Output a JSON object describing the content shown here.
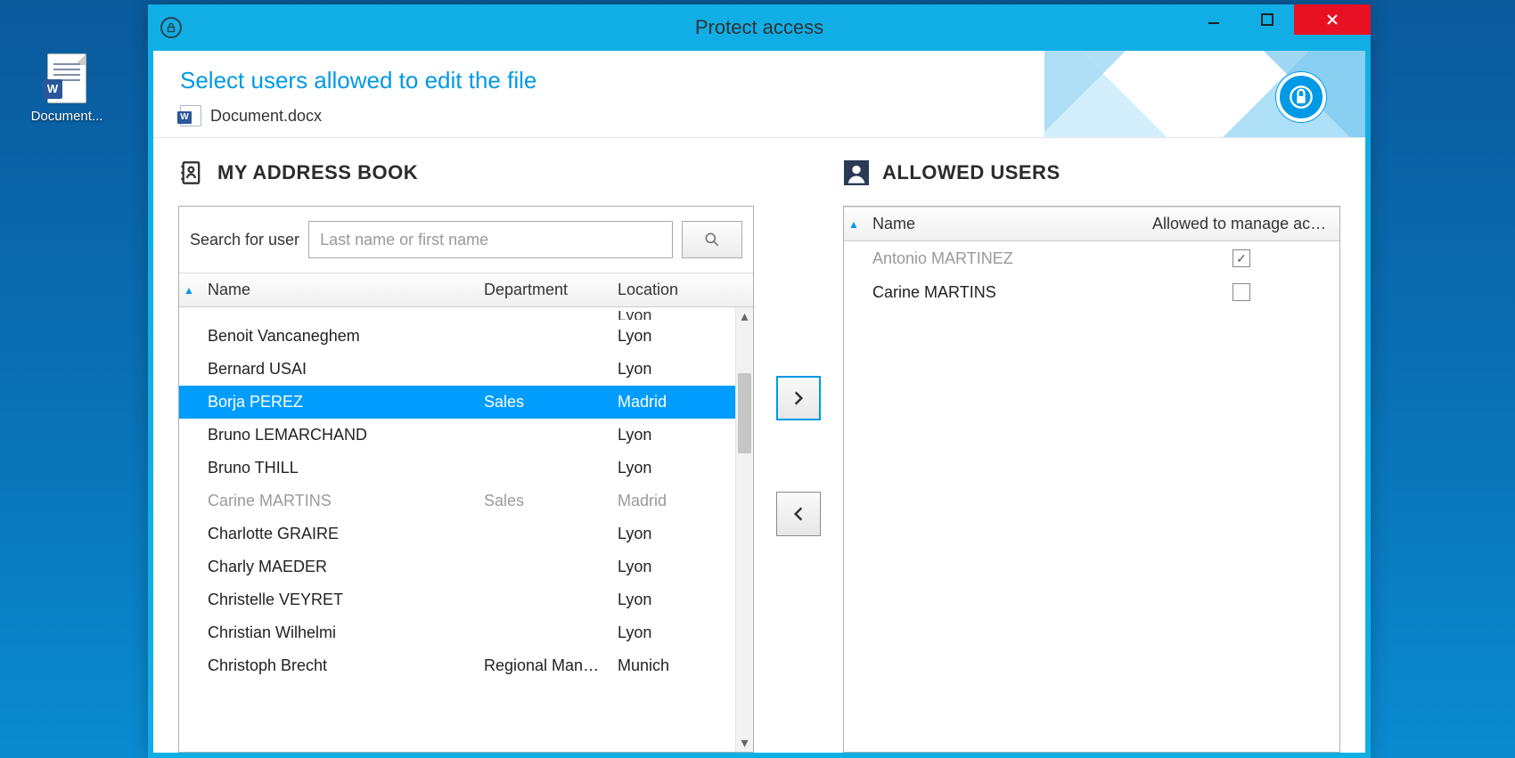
{
  "desktop": {
    "icon_label": "Document..."
  },
  "window": {
    "title": "Protect access"
  },
  "header": {
    "heading": "Select users allowed to edit the file",
    "filename": "Document.docx"
  },
  "address_book": {
    "title": "MY ADDRESS BOOK",
    "search_label": "Search for user",
    "search_placeholder": "Last name or first name",
    "columns": {
      "name": "Name",
      "department": "Department",
      "location": "Location"
    },
    "rows": [
      {
        "name": "Benoit Vancaneghem",
        "department": "",
        "location": "Lyon",
        "state": ""
      },
      {
        "name": "Bernard USAI",
        "department": "",
        "location": "Lyon",
        "state": ""
      },
      {
        "name": "Borja PEREZ",
        "department": "Sales",
        "location": "Madrid",
        "state": "selected"
      },
      {
        "name": "Bruno LEMARCHAND",
        "department": "",
        "location": "Lyon",
        "state": ""
      },
      {
        "name": "Bruno THILL",
        "department": "",
        "location": "Lyon",
        "state": ""
      },
      {
        "name": "Carine MARTINS",
        "department": "Sales",
        "location": "Madrid",
        "state": "dim"
      },
      {
        "name": "Charlotte GRAIRE",
        "department": "",
        "location": "Lyon",
        "state": ""
      },
      {
        "name": "Charly MAEDER",
        "department": "",
        "location": "Lyon",
        "state": ""
      },
      {
        "name": "Christelle VEYRET",
        "department": "",
        "location": "Lyon",
        "state": ""
      },
      {
        "name": "Christian Wilhelmi",
        "department": "",
        "location": "Lyon",
        "state": ""
      },
      {
        "name": "Christoph Brecht",
        "department": "Regional Mana...",
        "location": "Munich",
        "state": ""
      }
    ],
    "cut_row": {
      "location": "Lyon"
    }
  },
  "allowed": {
    "title": "ALLOWED USERS",
    "columns": {
      "name": "Name",
      "allow": "Allowed to manage access"
    },
    "rows": [
      {
        "name": "Antonio MARTINEZ",
        "checked": true,
        "state": "dim"
      },
      {
        "name": "Carine MARTINS",
        "checked": false,
        "state": ""
      }
    ]
  }
}
